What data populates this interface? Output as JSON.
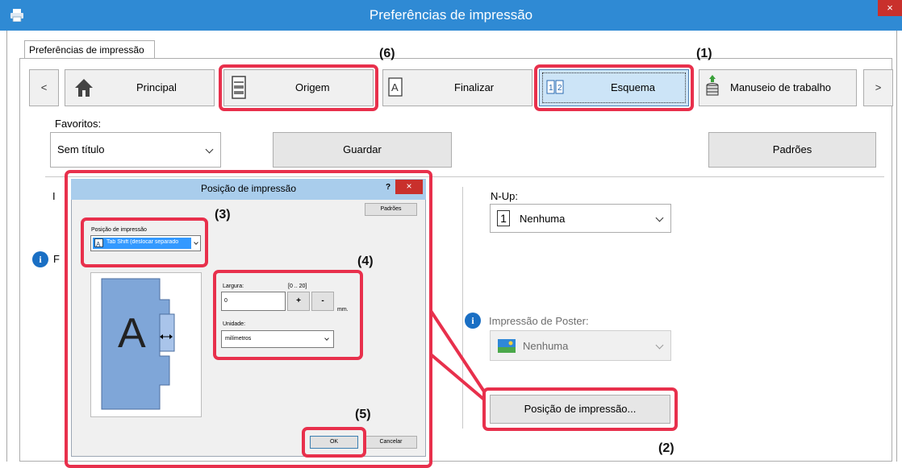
{
  "window": {
    "title": "Preferências de impressão",
    "close_glyph": "×",
    "printer_icon": "printer-icon"
  },
  "outer_tab": "Preferências de impressão",
  "tabs": [
    {
      "label": "Principal",
      "icon": "home-icon"
    },
    {
      "label": "Origem",
      "icon": "paper-tray-icon"
    },
    {
      "label": "Finalizar",
      "icon": "finish-icon"
    },
    {
      "label": "Esquema",
      "icon": "layout-icon"
    },
    {
      "label": "Manuseio de trabalho",
      "icon": "job-stack-icon"
    }
  ],
  "nav": {
    "prev": "<",
    "next": ">"
  },
  "favorites": {
    "label": "Favoritos:",
    "value": "Sem título",
    "save_label": "Guardar",
    "defaults_label": "Padrões"
  },
  "nup": {
    "label": "N-Up:",
    "value": "Nenhuma",
    "icon_text": "1"
  },
  "poster": {
    "label": "Impressão de Poster:",
    "value": "Nenhuma"
  },
  "print_position_button": "Posição de impressão...",
  "hidden_fragments": {
    "left_letter": "I",
    "info_letter": "F"
  },
  "dialog": {
    "title": "Posição de impressão",
    "help": "?",
    "close": "×",
    "defaults": "Padrões",
    "position_label": "Posição de impressão",
    "position_value": "Tab Shift (deslocar separado",
    "preview_letter": "A",
    "width_label": "Largura:",
    "width_range": "[0 .. 20]",
    "width_value": "0",
    "plus": "+",
    "minus": "-",
    "unit_suffix": "mm.",
    "unit_label": "Unidade:",
    "unit_value": "milímetros",
    "ok": "OK",
    "cancel": "Cancelar"
  },
  "callouts": [
    "(1)",
    "(2)",
    "(3)",
    "(4)",
    "(5)",
    "(6)"
  ],
  "colors": {
    "titlebar": "#2f8ad4",
    "highlight": "#e8304c",
    "dialog_title": "#a9cdec",
    "selected_tab": "#cce4f7"
  }
}
